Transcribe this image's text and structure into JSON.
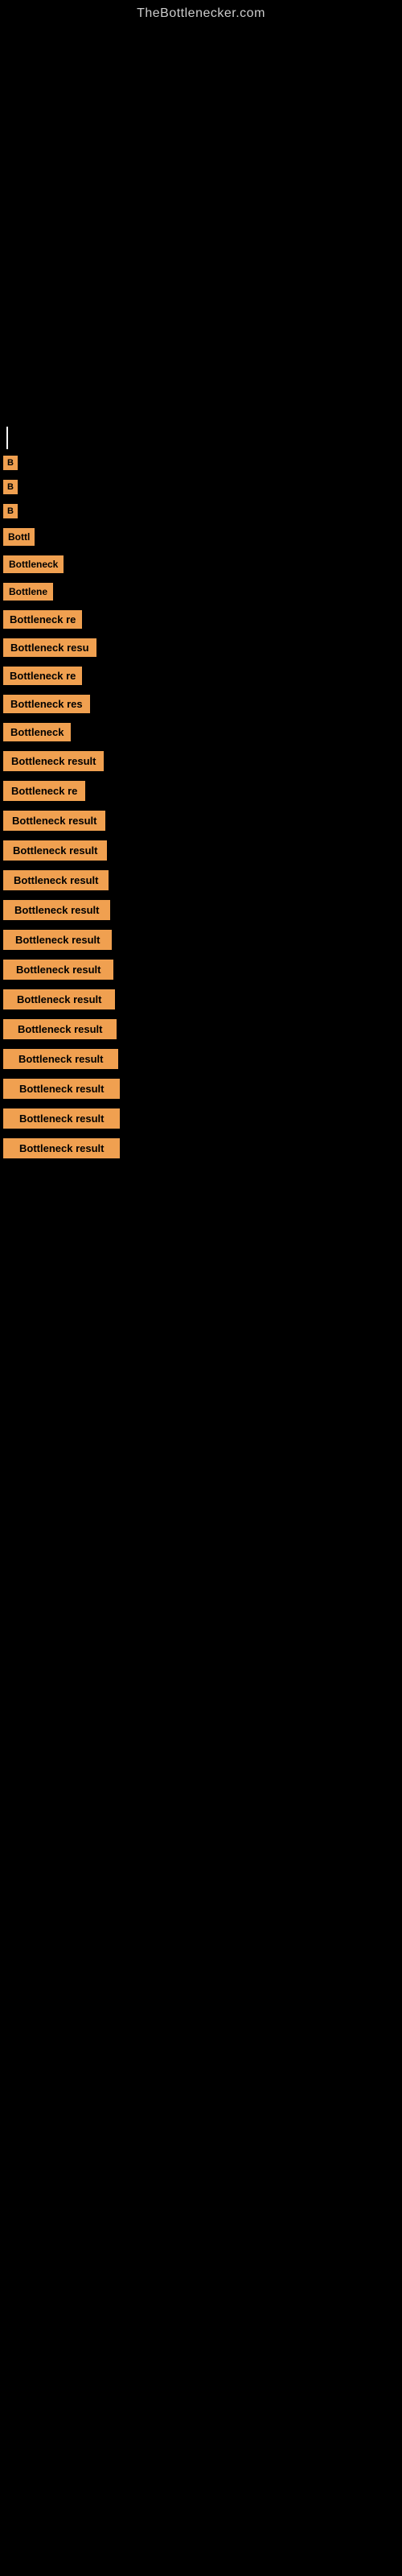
{
  "site": {
    "title": "TheBottlenecker.com"
  },
  "items": [
    {
      "id": 1,
      "label": "B",
      "short": true
    },
    {
      "id": 2,
      "label": "B",
      "short": true
    },
    {
      "id": 3,
      "label": "B",
      "short": true
    },
    {
      "id": 4,
      "label": "Bottl"
    },
    {
      "id": 5,
      "label": "Bottleneck"
    },
    {
      "id": 6,
      "label": "Bottlene"
    },
    {
      "id": 7,
      "label": "Bottleneck re"
    },
    {
      "id": 8,
      "label": "Bottleneck resu"
    },
    {
      "id": 9,
      "label": "Bottleneck re"
    },
    {
      "id": 10,
      "label": "Bottleneck res"
    },
    {
      "id": 11,
      "label": "Bottleneck"
    },
    {
      "id": 12,
      "label": "Bottleneck result"
    },
    {
      "id": 13,
      "label": "Bottleneck re"
    },
    {
      "id": 14,
      "label": "Bottleneck result"
    },
    {
      "id": 15,
      "label": "Bottleneck result"
    },
    {
      "id": 16,
      "label": "Bottleneck result"
    },
    {
      "id": 17,
      "label": "Bottleneck result"
    },
    {
      "id": 18,
      "label": "Bottleneck result"
    },
    {
      "id": 19,
      "label": "Bottleneck result"
    },
    {
      "id": 20,
      "label": "Bottleneck result"
    },
    {
      "id": 21,
      "label": "Bottleneck result"
    },
    {
      "id": 22,
      "label": "Bottleneck result"
    },
    {
      "id": 23,
      "label": "Bottleneck result"
    },
    {
      "id": 24,
      "label": "Bottleneck result"
    },
    {
      "id": 25,
      "label": "Bottleneck result"
    }
  ]
}
